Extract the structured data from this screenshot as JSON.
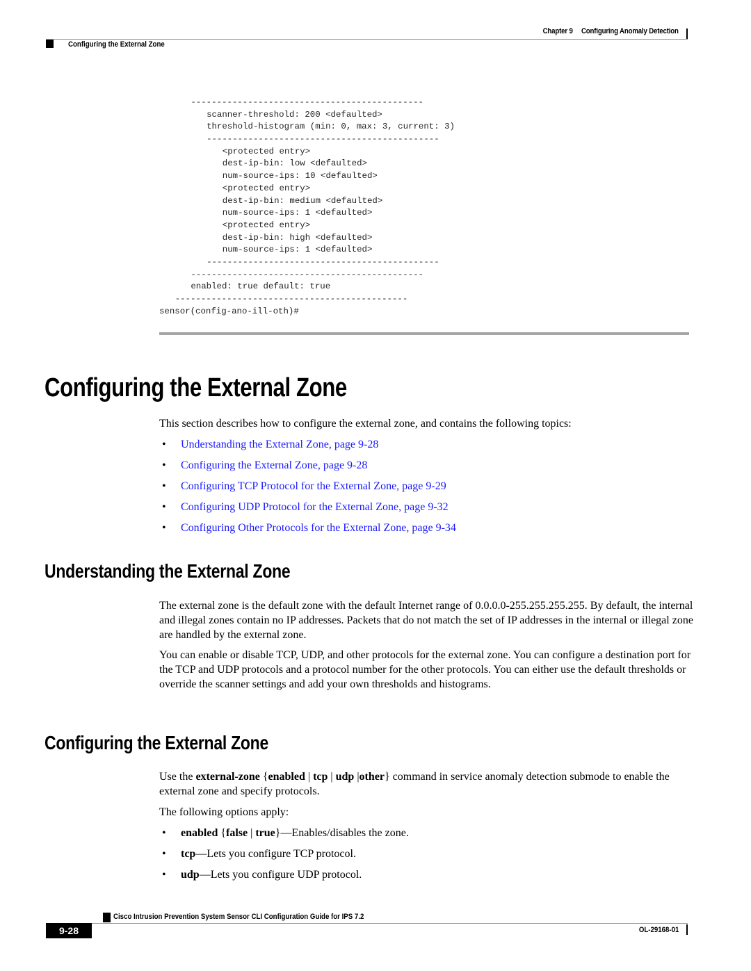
{
  "header": {
    "chapter_label": "Chapter 9",
    "chapter_title": "Configuring Anomaly Detection",
    "section_title": "Configuring the External Zone"
  },
  "code_block": {
    "lines": [
      {
        "indent": 6,
        "text": "---------------------------------------------"
      },
      {
        "indent": 9,
        "text": "scanner-threshold: 200 <defaulted>"
      },
      {
        "indent": 9,
        "text": "threshold-histogram (min: 0, max: 3, current: 3)"
      },
      {
        "indent": 9,
        "text": "---------------------------------------------"
      },
      {
        "indent": 12,
        "text": "<protected entry>"
      },
      {
        "indent": 12,
        "text": "dest-ip-bin: low <defaulted>"
      },
      {
        "indent": 12,
        "text": "num-source-ips: 10 <defaulted>"
      },
      {
        "indent": 12,
        "text": "<protected entry>"
      },
      {
        "indent": 12,
        "text": "dest-ip-bin: medium <defaulted>"
      },
      {
        "indent": 12,
        "text": "num-source-ips: 1 <defaulted>"
      },
      {
        "indent": 12,
        "text": "<protected entry>"
      },
      {
        "indent": 12,
        "text": "dest-ip-bin: high <defaulted>"
      },
      {
        "indent": 12,
        "text": "num-source-ips: 1 <defaulted>"
      },
      {
        "indent": 9,
        "text": "---------------------------------------------"
      },
      {
        "indent": 6,
        "text": "---------------------------------------------"
      },
      {
        "indent": 6,
        "text": "enabled: true default: true"
      },
      {
        "indent": 3,
        "text": "---------------------------------------------"
      },
      {
        "indent": 0,
        "text": "sensor(config-ano-ill-oth)#"
      }
    ]
  },
  "main": {
    "heading": "Configuring the External Zone",
    "intro": "This section describes how to configure the external zone, and contains the following topics:",
    "bullet_glyph": "•",
    "topics": [
      {
        "label": "Understanding the External Zone, page 9-28"
      },
      {
        "label": "Configuring the External Zone, page 9-28"
      },
      {
        "label": "Configuring TCP Protocol for the External Zone, page 9-29"
      },
      {
        "label": "Configuring UDP Protocol for the External Zone, page 9-32"
      },
      {
        "label": "Configuring Other Protocols for the External Zone, page 9-34"
      }
    ],
    "link_color": "#1a1aff"
  },
  "understanding": {
    "heading": "Understanding the External Zone",
    "paragraphs": [
      "The external zone is the default zone with the default Internet range of 0.0.0.0-255.255.255.255. By default, the internal and illegal zones contain no IP addresses. Packets that do not match the set of IP addresses in the internal or illegal zone are handled by the external zone.",
      "You can enable or disable TCP, UDP, and other protocols for the external zone. You can configure a destination port for the TCP and UDP protocols and a protocol number for the other protocols. You can either use the default thresholds or override the scanner settings and add your own thresholds and histograms."
    ]
  },
  "configuring": {
    "heading": "Configuring the External Zone",
    "usage": {
      "prefix": "Use the ",
      "command": "external-zone",
      "brace_open": " {",
      "opt1": "enabled",
      "sep1": " | ",
      "opt2": "tcp",
      "sep2": " | ",
      "opt3": "udp",
      "sep3": " |",
      "opt4": "other",
      "brace_close": "}",
      "suffix": " command in service anomaly detection submode to enable the external zone and specify protocols."
    },
    "options_intro": "The following options apply:",
    "options": [
      {
        "term": "enabled",
        "args_open": " {",
        "arg1": "false",
        "args_sep": " | ",
        "arg2": "true",
        "args_close": "}",
        "desc": "—Enables/disables the zone."
      },
      {
        "term": "tcp",
        "desc": "—Lets you configure TCP protocol."
      },
      {
        "term": "udp",
        "desc": "—Lets you configure UDP protocol."
      }
    ]
  },
  "footer": {
    "guide_title": "Cisco Intrusion Prevention System Sensor CLI Configuration Guide for IPS 7.2",
    "page_number": "9-28",
    "doc_id": "OL-29168-01"
  }
}
